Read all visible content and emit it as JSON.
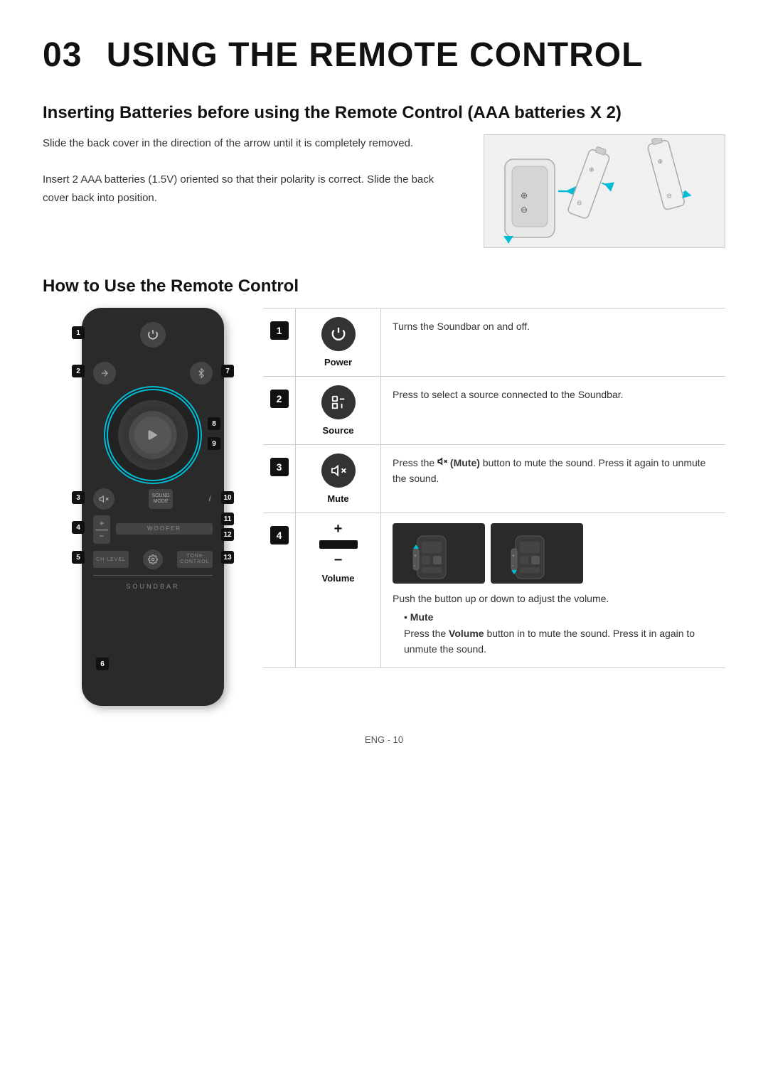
{
  "page": {
    "chapter": "03",
    "title": "USING THE REMOTE CONTROL"
  },
  "battery_section": {
    "heading": "Inserting Batteries before using the Remote Control (AAA batteries X 2)",
    "text1": "Slide the back cover in the direction of the arrow until it is completely removed.",
    "text2": "Insert 2 AAA batteries (1.5V) oriented so that their polarity is correct. Slide the back cover back into position."
  },
  "remote_section": {
    "heading": "How to Use the Remote Control"
  },
  "table": {
    "rows": [
      {
        "num": "1",
        "icon_label": "Power",
        "description": "Turns the Soundbar on and off."
      },
      {
        "num": "2",
        "icon_label": "Source",
        "description": "Press to select a source connected to the Soundbar."
      },
      {
        "num": "3",
        "icon_label": "Mute",
        "description_prefix": "Press the ",
        "description_bold": "(Mute)",
        "description_suffix": " button to mute the sound. Press it again to unmute the sound."
      },
      {
        "num": "4",
        "icon_label": "Volume",
        "desc_part1": "Push the button up or down to adjust the volume.",
        "bullet_title": "Mute",
        "desc_part2": "Press the ",
        "desc_bold": "Volume",
        "desc_part3": " button in to mute the sound. Press it in again to unmute the sound."
      }
    ]
  },
  "callouts": [
    "1",
    "2",
    "3",
    "4",
    "5",
    "6",
    "7",
    "8",
    "9",
    "10",
    "11",
    "12",
    "13"
  ],
  "footer": {
    "text": "ENG - 10"
  }
}
